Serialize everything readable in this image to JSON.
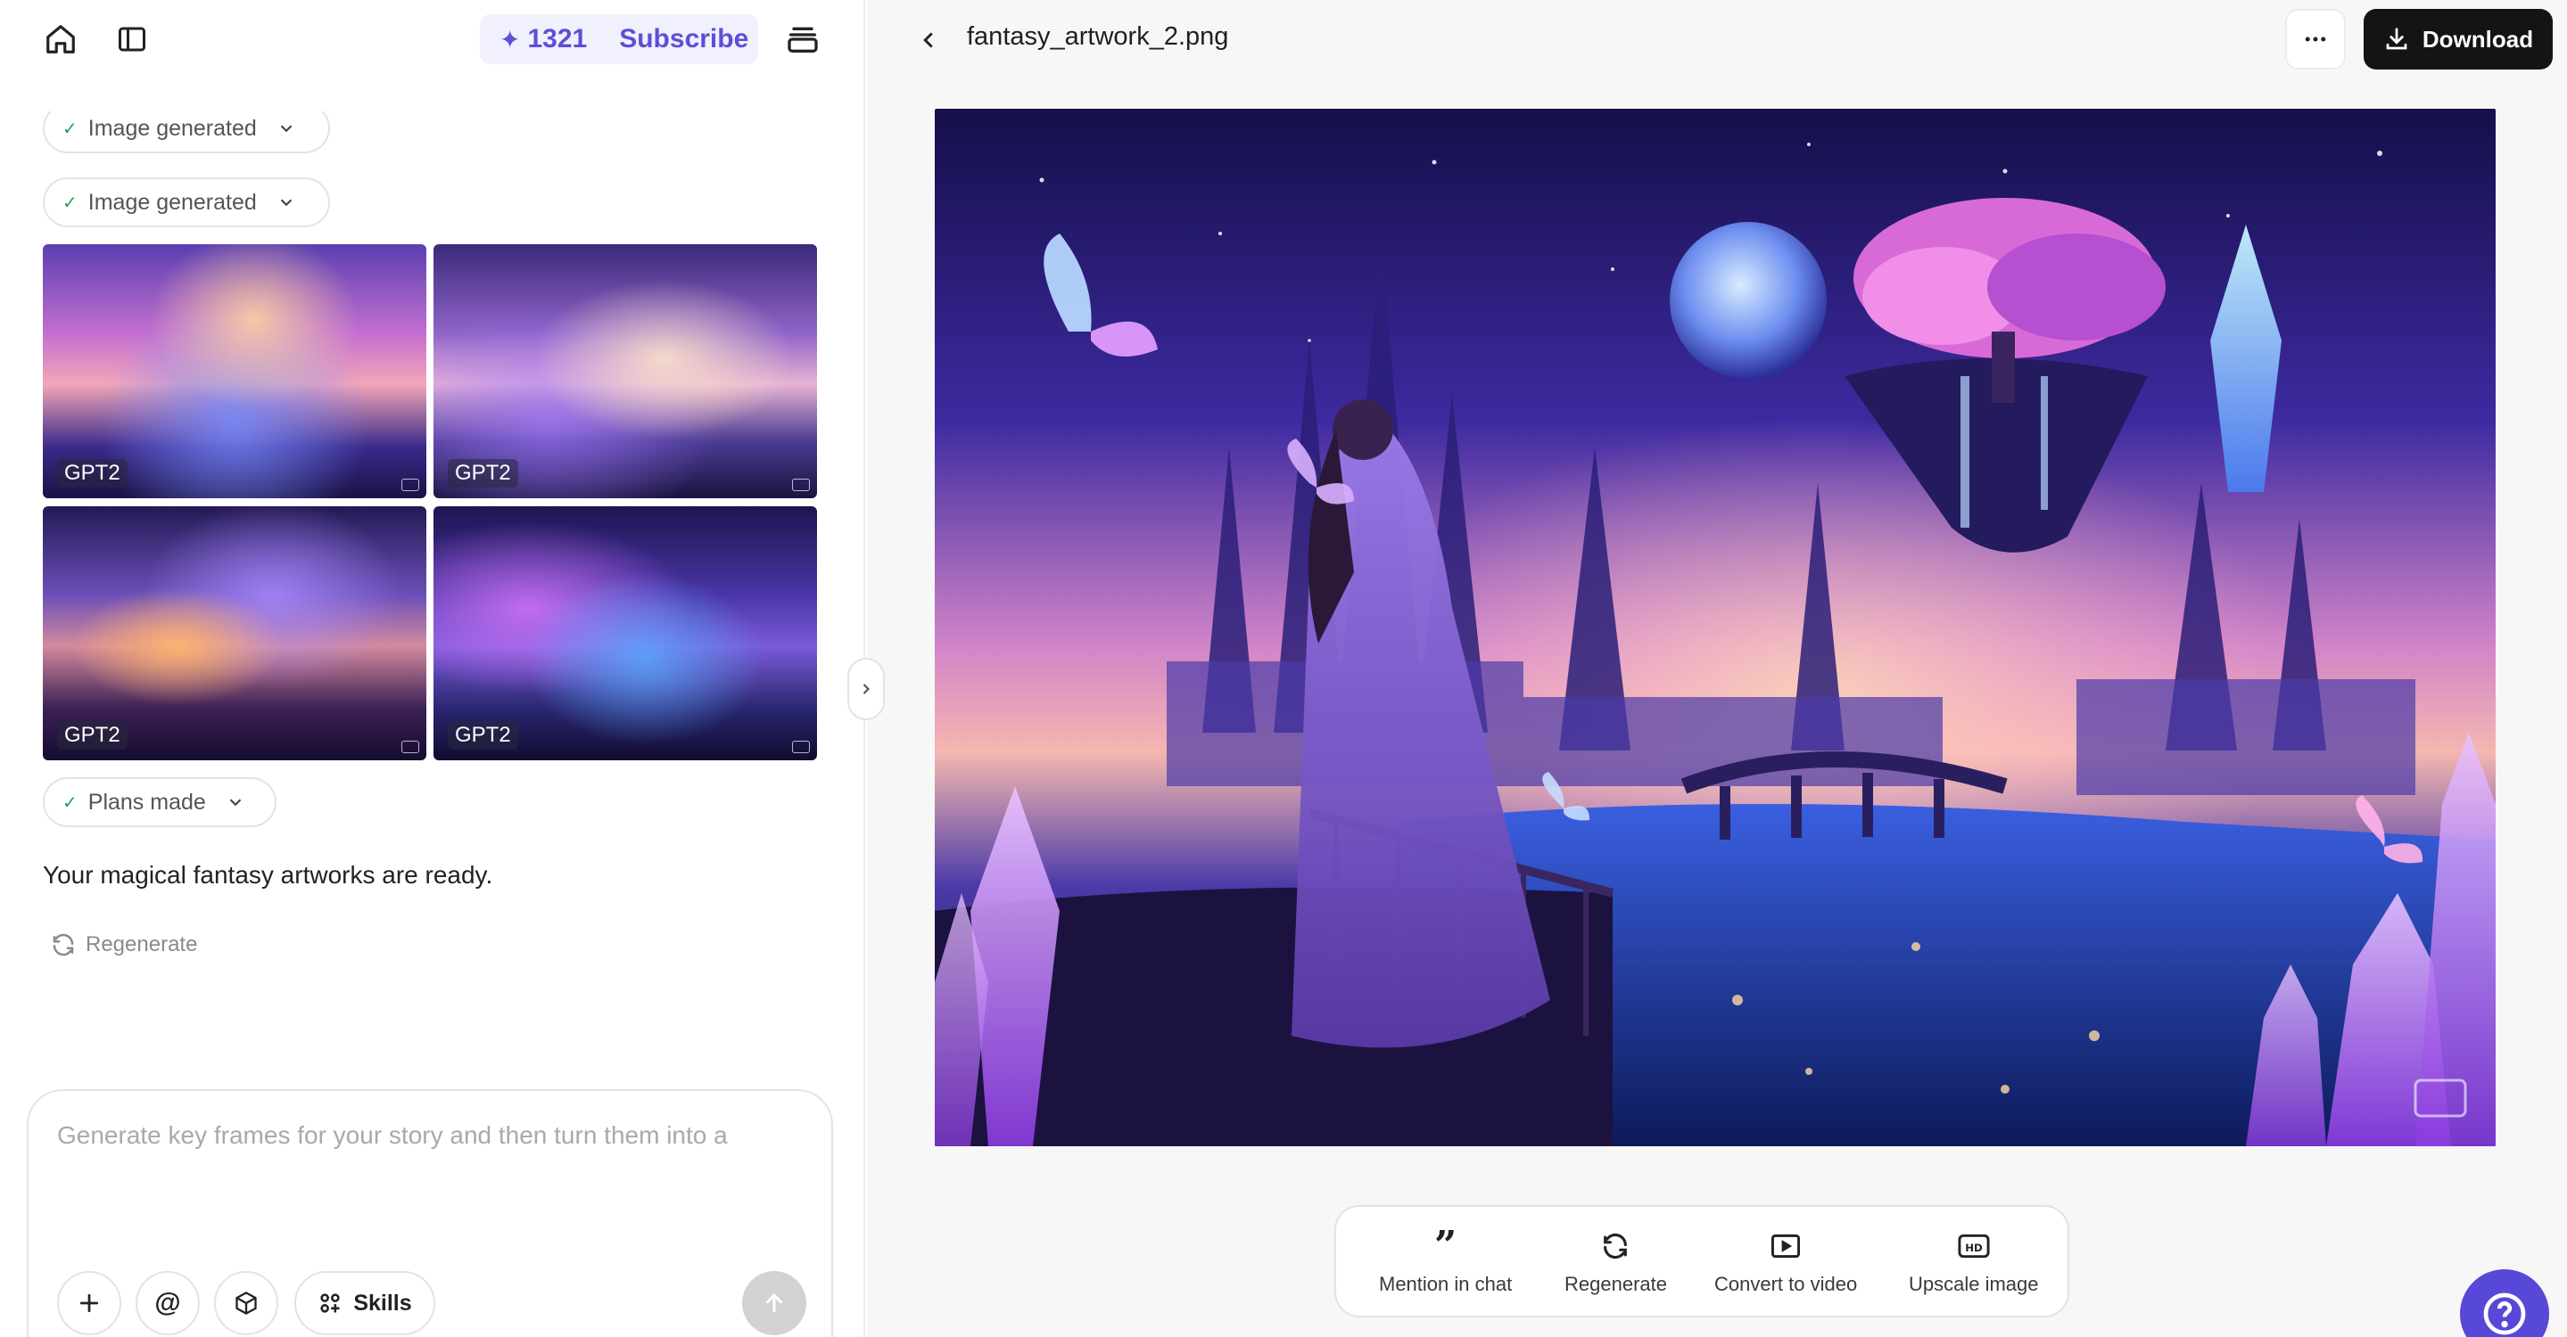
{
  "header": {
    "credits": "1321",
    "subscribe_label": "Subscribe",
    "icons": [
      "home-icon",
      "sidebar-toggle-icon",
      "sparkle-icon",
      "layers-icon"
    ]
  },
  "chat": {
    "status_items": [
      {
        "label": "Image generated"
      },
      {
        "label": "Image generated"
      },
      {
        "label": "Plans made"
      }
    ],
    "thumbnails": [
      {
        "model": "GPT2"
      },
      {
        "model": "GPT2"
      },
      {
        "model": "GPT2"
      },
      {
        "model": "GPT2"
      }
    ],
    "message": "Your magical fantasy artworks are ready.",
    "regenerate_label": "Regenerate"
  },
  "composer": {
    "placeholder": "Generate key frames for your story and then turn them into a",
    "skills_label": "Skills",
    "icons": [
      "plus-icon",
      "at-icon",
      "cube-icon",
      "skills-grid-icon",
      "send-arrow-icon"
    ]
  },
  "viewer": {
    "filename": "fantasy_artwork_2.png",
    "download_label": "Download",
    "actions": [
      {
        "label": "Mention in chat",
        "icon": "quote-icon"
      },
      {
        "label": "Regenerate",
        "icon": "refresh-icon"
      },
      {
        "label": "Convert to video",
        "icon": "play-icon"
      },
      {
        "label": "Upscale image",
        "icon": "hd-icon"
      }
    ]
  },
  "colors": {
    "accent": "#5b50d6",
    "help_button": "#5848d8",
    "download_button": "#141414",
    "check": "#22a35a"
  }
}
